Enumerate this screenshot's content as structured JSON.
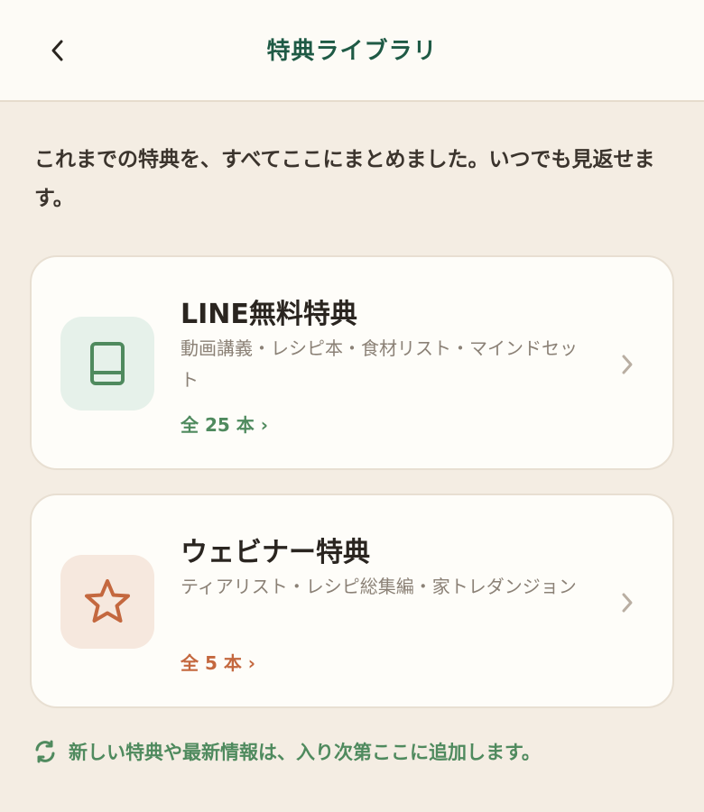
{
  "header": {
    "title": "特典ライブラリ",
    "back_icon": "chevron-left-icon"
  },
  "intro": "これまでの特典を、すべてここにまとめました。いつでも見返せます。",
  "cards": [
    {
      "title": "LINE無料特典",
      "description": "動画講義・レシピ本・食材リスト・マインドセット",
      "count": "全 25 本 ›",
      "icon": "book-icon",
      "accent": "#4f8a5e",
      "icon_bg": "#e6f1ea"
    },
    {
      "title": "ウェビナー特典",
      "description": "ティアリスト・レシピ総集編・家トレダンジョン",
      "count": "全 5 本 ›",
      "icon": "star-icon",
      "accent": "#c4683f",
      "icon_bg": "#f6e8de"
    }
  ],
  "footer": {
    "icon": "refresh-icon",
    "text": "新しい特典や最新情報は、入り次第ここに追加します。"
  }
}
